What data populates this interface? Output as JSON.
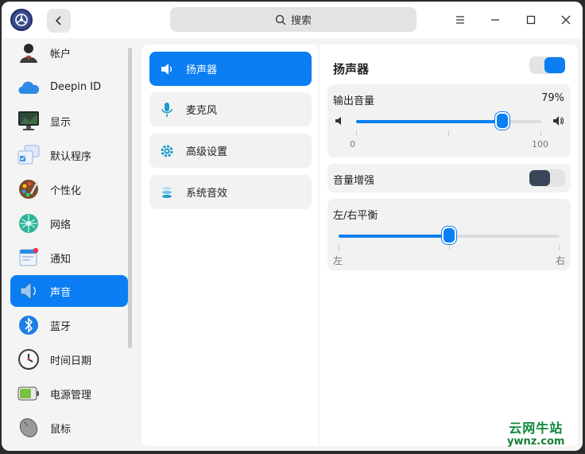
{
  "titlebar": {
    "search_placeholder": "搜索"
  },
  "sidebar": {
    "items": [
      {
        "label": "帐户",
        "icon": "account-icon"
      },
      {
        "label": "Deepin ID",
        "icon": "cloud-icon"
      },
      {
        "label": "显示",
        "icon": "monitor-icon"
      },
      {
        "label": "默认程序",
        "icon": "default-apps-icon"
      },
      {
        "label": "个性化",
        "icon": "palette-icon"
      },
      {
        "label": "网络",
        "icon": "network-icon"
      },
      {
        "label": "通知",
        "icon": "notification-icon"
      },
      {
        "label": "声音",
        "icon": "speaker-icon",
        "active": true
      },
      {
        "label": "蓝牙",
        "icon": "bluetooth-icon"
      },
      {
        "label": "时间日期",
        "icon": "clock-icon"
      },
      {
        "label": "电源管理",
        "icon": "battery-icon"
      },
      {
        "label": "鼠标",
        "icon": "mouse-icon"
      }
    ]
  },
  "submenu": {
    "items": [
      {
        "label": "扬声器",
        "icon": "speaker-icon",
        "active": true
      },
      {
        "label": "麦克风",
        "icon": "microphone-icon"
      },
      {
        "label": "高级设置",
        "icon": "gear-icon"
      },
      {
        "label": "系统音效",
        "icon": "sound-effects-icon"
      }
    ]
  },
  "detail": {
    "title": "扬声器",
    "speaker_enabled": true,
    "output_volume": {
      "label": "输出音量",
      "value_text": "79%",
      "value": 0.79,
      "min_label": "0",
      "max_label": "100"
    },
    "volume_boost": {
      "label": "音量增强",
      "enabled": false
    },
    "balance": {
      "label": "左/右平衡",
      "value": 0.5,
      "left_label": "左",
      "right_label": "右"
    }
  },
  "watermark": {
    "cn": "云网牛站",
    "en": "ywnz.com"
  },
  "colors": {
    "accent": "#0a7ef2",
    "toggle_off_knob": "#3b4558"
  }
}
